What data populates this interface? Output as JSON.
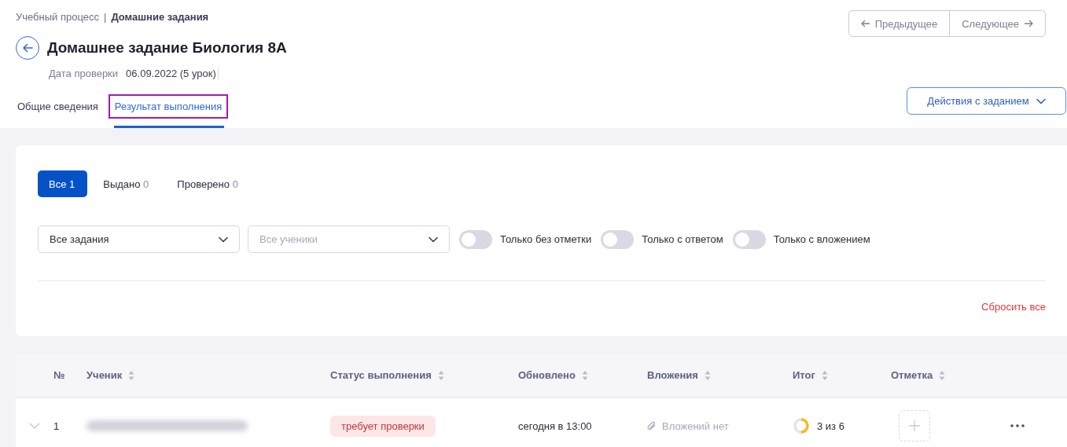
{
  "breadcrumb": {
    "items": [
      {
        "label": "Учебный процесс",
        "current": false
      },
      {
        "label": "Домашние задания",
        "current": true
      }
    ],
    "separator": "|"
  },
  "title": "Домашнее задание Биология 8А",
  "check_date": {
    "label": "Дата проверки",
    "value": "06.09.2022 (5 урок)"
  },
  "pager": {
    "previous": "Предыдущее",
    "next": "Следующее"
  },
  "tabs": [
    {
      "label": "Общие сведения",
      "selected": false,
      "highlighted": false
    },
    {
      "label": "Результат выполнения",
      "selected": true,
      "highlighted": true
    }
  ],
  "actions_button": "Действия с заданием",
  "status_filter": [
    {
      "label": "Все",
      "count": "1",
      "selected": true
    },
    {
      "label": "Выдано",
      "count": "0",
      "selected": false
    },
    {
      "label": "Проверено",
      "count": "0",
      "selected": false
    }
  ],
  "dropdowns": [
    {
      "value": "Все задания"
    },
    {
      "placeholder": "Все ученики"
    }
  ],
  "toggles": [
    {
      "label": "Только без отметки",
      "on": false
    },
    {
      "label": "Только с ответом",
      "on": false
    },
    {
      "label": "Только с вложением",
      "on": false
    }
  ],
  "reset_link": "Сбросить все",
  "table": {
    "columns": [
      {
        "label": "№",
        "sortable": false
      },
      {
        "label": "Ученик",
        "sortable": true
      },
      {
        "label": "Статус выполнения",
        "sortable": true
      },
      {
        "label": "Обновлено",
        "sortable": true
      },
      {
        "label": "Вложения",
        "sortable": true
      },
      {
        "label": "Итог",
        "sortable": true
      },
      {
        "label": "Отметка",
        "sortable": true
      }
    ],
    "rows": [
      {
        "number": "1",
        "expanded": false,
        "status": "требует проверки",
        "updated": "сегодня в 13:00",
        "attachments": "Вложений нет",
        "result": {
          "level": 0.5,
          "text": "3 из 6"
        }
      }
    ]
  }
}
